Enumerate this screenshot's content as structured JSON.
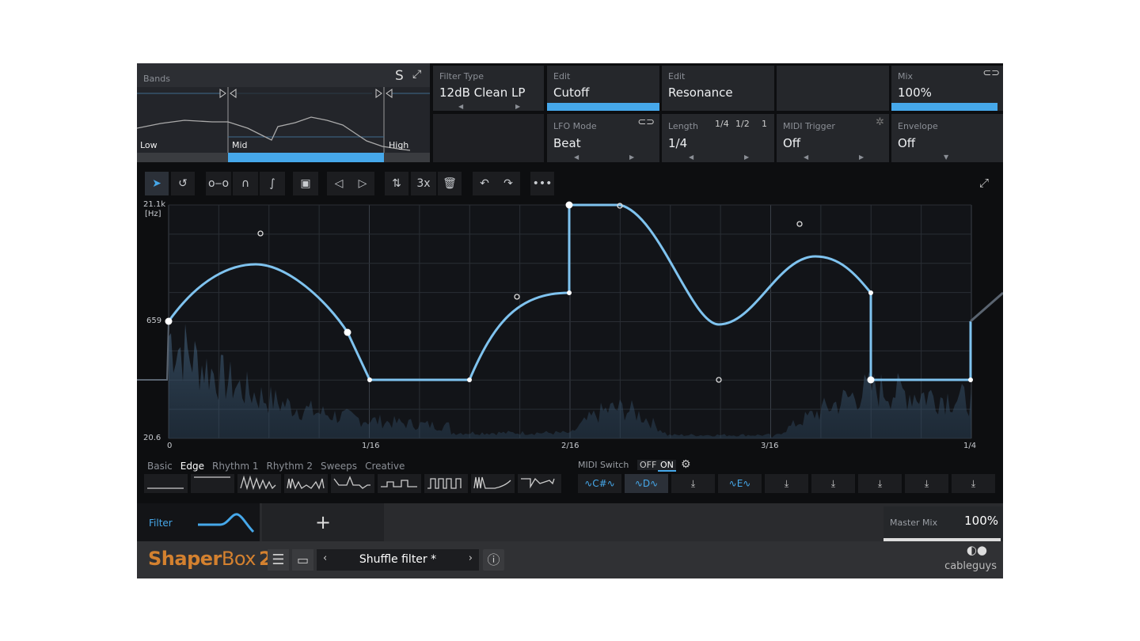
{
  "bands": {
    "title": "Bands",
    "solo_label": "S",
    "low": "Low",
    "mid": "Mid",
    "high": "High"
  },
  "filter_type": {
    "label": "Filter Type",
    "value": "12dB Clean LP"
  },
  "edit1": {
    "label": "Edit",
    "value": "Cutoff"
  },
  "edit2": {
    "label": "Edit",
    "value": "Resonance"
  },
  "mix": {
    "label": "Mix",
    "value": "100%",
    "level": 1.0
  },
  "lfo_mode": {
    "label": "LFO Mode",
    "value": "Beat"
  },
  "length": {
    "label": "Length",
    "value": "1/4",
    "options": [
      "1/4",
      "1/2",
      "1"
    ]
  },
  "midi_trigger": {
    "label": "MIDI Trigger",
    "value": "Off"
  },
  "envelope": {
    "label": "Envelope",
    "value": "Off"
  },
  "toolbar": {
    "multiplier": "3x"
  },
  "graph": {
    "y_labels": [
      "21.1k",
      "[Hz]",
      "659",
      "20.6"
    ],
    "x_labels": [
      "0",
      "1/16",
      "2/16",
      "3/16",
      "1/4"
    ]
  },
  "library": {
    "tabs": [
      "Basic",
      "Edge",
      "Rhythm 1",
      "Rhythm 2",
      "Sweeps",
      "Creative"
    ],
    "active_tab": "Edge"
  },
  "midi_switch": {
    "label": "MIDI Switch",
    "off": "OFF",
    "on": "ON",
    "active": "ON",
    "slots": [
      "C#",
      "D",
      "",
      "E",
      "",
      "",
      "",
      "",
      ""
    ]
  },
  "layers": {
    "filter_label": "Filter",
    "add": "+"
  },
  "master_mix": {
    "label": "Master Mix",
    "value": "100%",
    "level": 1.0
  },
  "footer": {
    "brand_a": "Shaper",
    "brand_b": "Box",
    "brand_c": "2",
    "preset": "Shuffle filter *",
    "maker": "cableguys"
  },
  "colors": {
    "accent": "#46a8ea",
    "brand": "#d4812f",
    "panel": "#25272b"
  }
}
